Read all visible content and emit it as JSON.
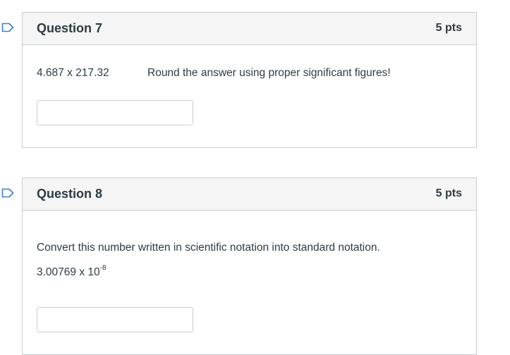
{
  "question7": {
    "title": "Question 7",
    "points": "5 pts",
    "expression": "4.687 x 217.32",
    "instruction": "Round the answer using proper significant figures!",
    "answer_value": ""
  },
  "question8": {
    "title": "Question 8",
    "points": "5 pts",
    "prompt": "Convert this number written in scientific notation into standard notation.",
    "number_base": "3.00769 x 10",
    "number_exponent": "-8",
    "answer_value": ""
  },
  "icons": {
    "flag": "bookmark-flag-icon"
  },
  "colors": {
    "flag_stroke": "#3c7dd3",
    "header_bg": "#f5f5f5",
    "border": "#c7cdd1",
    "text": "#2d3b45"
  }
}
